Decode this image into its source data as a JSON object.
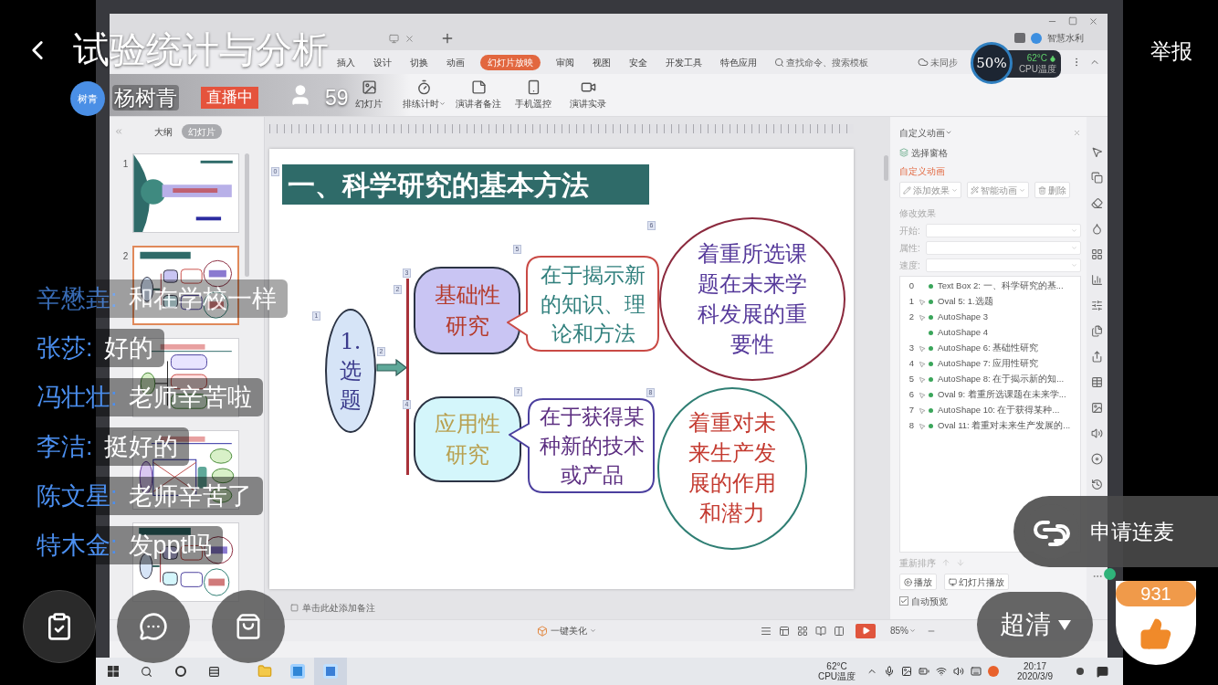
{
  "live": {
    "title": "试验统计与分析",
    "host_avatar": "树青",
    "host_name": "杨树青",
    "status": "直播中",
    "viewers": "59",
    "report": "举报"
  },
  "screen": {
    "account": "智慧水利",
    "menu": [
      {
        "label": "插入",
        "selected": false
      },
      {
        "label": "设计",
        "selected": false
      },
      {
        "label": "切换",
        "selected": false
      },
      {
        "label": "动画",
        "selected": false
      },
      {
        "label": "幻灯片放映",
        "selected": true
      },
      {
        "label": "审阅",
        "selected": false
      },
      {
        "label": "视图",
        "selected": false
      },
      {
        "label": "安全",
        "selected": false
      },
      {
        "label": "开发工具",
        "selected": false
      },
      {
        "label": "特色应用",
        "selected": false
      }
    ],
    "command_search": {
      "placeholder": "查找命令、搜索模板"
    },
    "sync": "未同步",
    "cpu_widget": {
      "load": "50%",
      "temperature": "62°C",
      "label": "CPU温度"
    },
    "tools": [
      {
        "label": "幻灯片",
        "dropdown": false
      },
      {
        "label": "排练计时",
        "dropdown": true
      },
      {
        "label": "演讲者备注",
        "dropdown": false
      },
      {
        "label": "手机遥控",
        "dropdown": false
      },
      {
        "label": "演讲实录",
        "dropdown": false
      }
    ],
    "panel_tabs": [
      {
        "label": "大纲",
        "selected": false
      },
      {
        "label": "幻灯片",
        "selected": true
      }
    ],
    "thumbnails": [
      {
        "number": "1",
        "kind": "title",
        "selected": false
      },
      {
        "number": "2",
        "kind": "branches",
        "selected": true
      },
      {
        "kind": "tree",
        "selected": false
      },
      {
        "kind": "cross",
        "selected": false
      },
      {
        "kind": "branches",
        "selected": false
      }
    ],
    "slide": {
      "title": {
        "text": "一、科学研究的基本方法",
        "tag": "0"
      },
      "topic": {
        "lines": [
          "1.",
          "选",
          "题"
        ],
        "tag": "1"
      },
      "arrow_tags": [
        "2",
        "2"
      ],
      "branches": [
        {
          "box": {
            "lines": [
              "基础性",
              "研究"
            ],
            "tag": "3"
          },
          "callout": {
            "lines": [
              "在于揭示新",
              "的知识、理",
              "论和方法"
            ],
            "tag": "5"
          },
          "circle": {
            "lines": [
              "着重所选课",
              "题在未来学",
              "科发展的重",
              "要性"
            ],
            "tag": "6"
          }
        },
        {
          "box": {
            "lines": [
              "应用性",
              "研究"
            ],
            "tag": "4"
          },
          "callout": {
            "lines": [
              "在于获得某",
              "种新的技术",
              "或产品"
            ],
            "tag": "7"
          },
          "circle": {
            "lines": [
              "着重对未",
              "来生产发",
              "展的作用",
              "和潜力"
            ],
            "tag": "8"
          }
        }
      ]
    },
    "notes": {
      "placeholder": "单击此处添加备注"
    },
    "animation_pane": {
      "title": "自定义动画",
      "selection_pane": "选择窗格",
      "section": "自定义动画",
      "buttons": [
        {
          "label": "添加效果",
          "dropdown": true
        },
        {
          "label": "智能动画",
          "dropdown": true
        },
        {
          "label": "删除",
          "dropdown": false
        }
      ],
      "modify_heading": "修改效果",
      "fields": [
        {
          "label": "开始:"
        },
        {
          "label": "属性:"
        },
        {
          "label": "速度:"
        }
      ],
      "items": [
        {
          "index": "0",
          "click": false,
          "label": "Text Box 2: 一、科学研究的基..."
        },
        {
          "index": "1",
          "click": true,
          "label": "Oval 5: 1.选题"
        },
        {
          "index": "2",
          "click": true,
          "label": "AutoShape 3"
        },
        {
          "click": false,
          "label": "AutoShape 4"
        },
        {
          "index": "3",
          "click": true,
          "label": "AutoShape 6: 基础性研究"
        },
        {
          "index": "4",
          "click": true,
          "label": "AutoShape 7: 应用性研究"
        },
        {
          "index": "5",
          "click": true,
          "label": "AutoShape 8: 在于揭示新的知..."
        },
        {
          "index": "6",
          "click": true,
          "label": "Oval 9: 着重所选课题在未来学..."
        },
        {
          "index": "7",
          "click": true,
          "label": "AutoShape 10: 在于获得某种..."
        },
        {
          "index": "8",
          "click": true,
          "label": "Oval 11: 着重对未来生产发展的..."
        }
      ],
      "reorder": "重新排序",
      "play": "播放",
      "slideshow": "幻灯片播放",
      "autopreview": {
        "label": "自动预览",
        "checked": true
      }
    },
    "status_bar": {
      "beautify": "一键美化",
      "zoom": "85%"
    }
  },
  "taskbar": {
    "temperature": "62°C",
    "temperature_label": "CPU温度",
    "time": "20:17",
    "date": "2020/3/9"
  },
  "chat": [
    {
      "sender": "辛懋垚:",
      "message": "和在学校一样",
      "faded": true
    },
    {
      "sender": "张莎:",
      "message": "好的",
      "faded": false
    },
    {
      "sender": "冯壮壮:",
      "message": "老师辛苦啦",
      "faded": false
    },
    {
      "sender": "李洁:",
      "message": "挺好的",
      "faded": false
    },
    {
      "sender": "陈文星:",
      "message": "老师辛苦了",
      "faded": false
    },
    {
      "sender": "特木金:",
      "message": "发ppt吗",
      "faded": false
    }
  ],
  "controls": {
    "mic_request": "申请连麦",
    "quality": "超清",
    "likes": "931"
  }
}
